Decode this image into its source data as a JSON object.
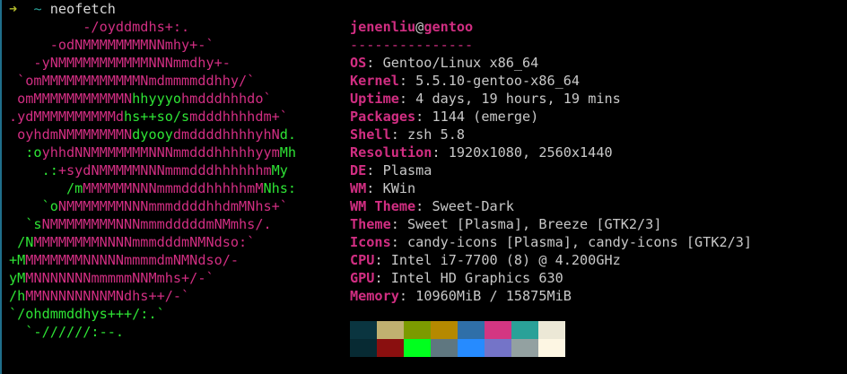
{
  "prompt": {
    "arrow": "➜",
    "dir": "~",
    "command": "neofetch"
  },
  "logo": {
    "lines": [
      [
        {
          "t": "         -/oyddmdhs+:.",
          "c": "m"
        }
      ],
      [
        {
          "t": "     -odNMMMMMMMMNNmhy+-`",
          "c": "m"
        }
      ],
      [
        {
          "t": "   -yNMMMMMMMMMMMNNNmmdhy+-",
          "c": "m"
        }
      ],
      [
        {
          "t": " `omMMMMMMMMMMMMNmdmmmmddhhy/`",
          "c": "m"
        }
      ],
      [
        {
          "t": " omMMMMMMMMMMMN",
          "c": "m"
        },
        {
          "t": "hhyyyo",
          "c": "g"
        },
        {
          "t": "hmdddhhhdo`",
          "c": "m"
        }
      ],
      [
        {
          "t": ".ydMMMMMMMMMMd",
          "c": "m"
        },
        {
          "t": "hs++so/s",
          "c": "g"
        },
        {
          "t": "mdddhhhhdm+`",
          "c": "m"
        }
      ],
      [
        {
          "t": " oyhdmNMMMMMMMN",
          "c": "m"
        },
        {
          "t": "dyooy",
          "c": "g"
        },
        {
          "t": "dmddddhhhhyhN",
          "c": "m"
        },
        {
          "t": "d.",
          "c": "g"
        }
      ],
      [
        {
          "t": "  :o",
          "c": "g"
        },
        {
          "t": "yhhdNNMMMMMMMNNNmmdddhhhhhyym",
          "c": "m"
        },
        {
          "t": "Mh",
          "c": "g"
        }
      ],
      [
        {
          "t": "    .:",
          "c": "g"
        },
        {
          "t": "+sydNMMMMMNNNmmmdddhhhhhhm",
          "c": "m"
        },
        {
          "t": "My",
          "c": "g"
        }
      ],
      [
        {
          "t": "       /m",
          "c": "g"
        },
        {
          "t": "MMMMMMNNNmmmdddhhhhhmM",
          "c": "m"
        },
        {
          "t": "Nhs:",
          "c": "g"
        }
      ],
      [
        {
          "t": "    `o",
          "c": "g"
        },
        {
          "t": "NMMMMMMMNNNmmmddddhhdmMNhs+`",
          "c": "m"
        }
      ],
      [
        {
          "t": "  `s",
          "c": "g"
        },
        {
          "t": "NMMMMMMMMNNNmmmdddddmNMmhs/.",
          "c": "m"
        }
      ],
      [
        {
          "t": " /N",
          "c": "g"
        },
        {
          "t": "MMMMMMMMNNNNmmmdddmNMNdso:`",
          "c": "m"
        }
      ],
      [
        {
          "t": "+M",
          "c": "g"
        },
        {
          "t": "MMMMMMMNNNNNmmmmdmNMNdso/-",
          "c": "m"
        }
      ],
      [
        {
          "t": "yM",
          "c": "g"
        },
        {
          "t": "MNNNNNNNmmmmmNNMmhs+/-`",
          "c": "m"
        }
      ],
      [
        {
          "t": "/h",
          "c": "g"
        },
        {
          "t": "MMNNNNNNNNMNdhs++/-`",
          "c": "m"
        }
      ],
      [
        {
          "t": "`/ohdmmddhys+++/:.`",
          "c": "g"
        }
      ],
      [
        {
          "t": "  `-//////:--.",
          "c": "g"
        }
      ]
    ]
  },
  "info": {
    "user": "jenenliu",
    "at": "@",
    "host": "gentoo",
    "separator": "---------------",
    "rows": [
      {
        "key": "OS",
        "value": "Gentoo/Linux x86_64"
      },
      {
        "key": "Kernel",
        "value": "5.5.10-gentoo-x86_64"
      },
      {
        "key": "Uptime",
        "value": "4 days, 19 hours, 19 mins"
      },
      {
        "key": "Packages",
        "value": "1144 (emerge)"
      },
      {
        "key": "Shell",
        "value": "zsh 5.8"
      },
      {
        "key": "Resolution",
        "value": "1920x1080, 2560x1440"
      },
      {
        "key": "DE",
        "value": "Plasma"
      },
      {
        "key": "WM",
        "value": "KWin"
      },
      {
        "key": "WM Theme",
        "value": "Sweet-Dark"
      },
      {
        "key": "Theme",
        "value": "Sweet [Plasma], Breeze [GTK2/3]"
      },
      {
        "key": "Icons",
        "value": "candy-icons [Plasma], candy-icons [GTK2/3]"
      },
      {
        "key": "CPU",
        "value": "Intel i7-7700 (8) @ 4.200GHz"
      },
      {
        "key": "GPU",
        "value": "Intel HD Graphics 630"
      },
      {
        "key": "Memory",
        "value": "10960MiB / 15875MiB"
      }
    ]
  },
  "palette": {
    "colors": [
      "#0a3540",
      "#c0b070",
      "#7c9a00",
      "#b58900",
      "#2f6fa8",
      "#d33682",
      "#2aa198",
      "#ece8d6",
      "#072a33",
      "#8a0f0f",
      "#00ff1e",
      "#5f7780",
      "#268bff",
      "#7474c8",
      "#93a1a1",
      "#fdf6e3"
    ]
  }
}
